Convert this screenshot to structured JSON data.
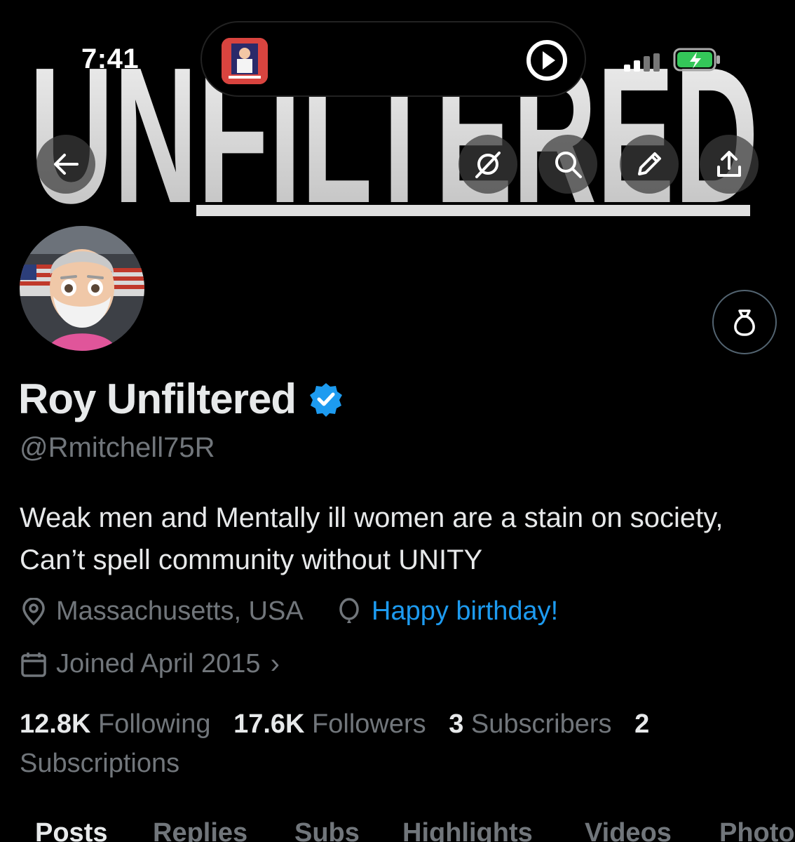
{
  "status_bar": {
    "time": "7:41"
  },
  "banner": {
    "word": "UNFILTERED"
  },
  "profile": {
    "display_name": "Roy Unfiltered",
    "handle": "@Rmitchell75R",
    "bio": "Weak men and Mentally ill women are a stain on society, Can’t spell community without UNITY",
    "location": "Massachusetts, USA",
    "birthday": "Happy birthday!",
    "joined": "Joined April 2015"
  },
  "stats": {
    "following_count": "12.8K",
    "following_label": "Following",
    "followers_count": "17.6K",
    "followers_label": "Followers",
    "subscribers_count": "3",
    "subscribers_label": "Subscribers",
    "subscriptions_count": "2",
    "subscriptions_label": "Subscriptions"
  },
  "tabs": [
    "Posts",
    "Replies",
    "Subs",
    "Highlights",
    "Videos",
    "Photos"
  ],
  "colors": {
    "accent": "#1d9bf0",
    "muted": "#71767b",
    "text": "#e7e9ea",
    "background": "#000000"
  }
}
